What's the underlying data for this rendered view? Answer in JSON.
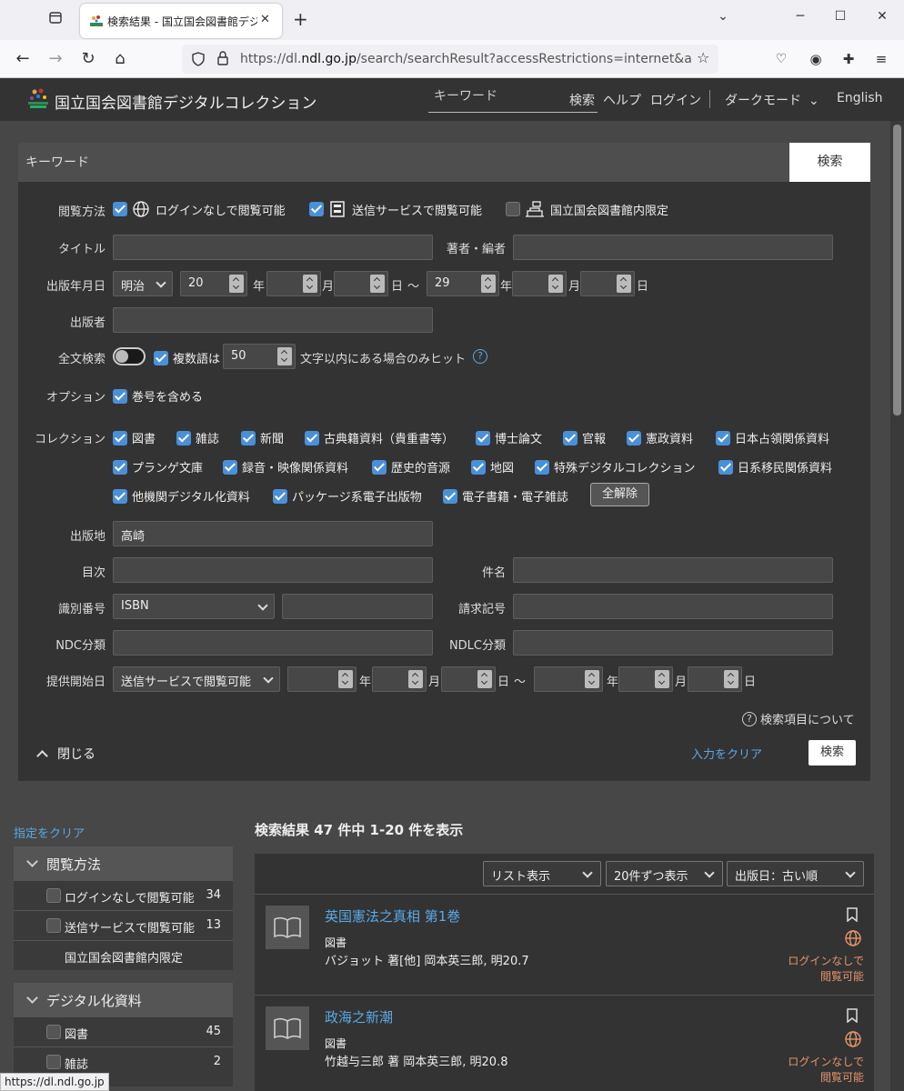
{
  "browser": {
    "tab_title": "検索結果 - 国立国会図書館デジタ",
    "url_prefix": "https://dl.",
    "url_domain": "ndl.go.jp",
    "url_rest": "/search/searchResult?accessRestrictions=internet&accessRestr",
    "status_url": "https://dl.ndl.go.jp"
  },
  "header": {
    "site_title": "国立国会図書館デジタルコレクション",
    "search_placeholder": "キーワード",
    "search_label": "検索",
    "help_label": "ヘルプ",
    "login_label": "ログイン",
    "dark_mode_label": "ダークモード",
    "english_label": "English"
  },
  "search_panel": {
    "keyword_placeholder": "キーワード",
    "search_button": "検索",
    "access": {
      "label": "閲覧方法",
      "options": [
        {
          "label": "ログインなしで閲覧可能",
          "checked": true,
          "icon": "globe-icon"
        },
        {
          "label": "送信サービスで閲覧可能",
          "checked": true,
          "icon": "building-icon"
        },
        {
          "label": "国立国会図書館内限定",
          "checked": false,
          "icon": "library-icon"
        }
      ]
    },
    "title_label": "タイトル",
    "author_label": "著者・編者",
    "pubdate": {
      "label": "出版年月日",
      "era": "明治",
      "from_year": "20",
      "to_year": "29",
      "year_unit": "年",
      "month_unit": "月",
      "day_unit": "日",
      "tilde": "～"
    },
    "publisher_label": "出版者",
    "fulltext": {
      "label": "全文検索",
      "multi_word_label": "複数語は",
      "distance": "50",
      "suffix": "文字以内にある場合のみヒット",
      "help": "?"
    },
    "option": {
      "label": "オプション",
      "include_volume": "巻号を含める"
    },
    "collection": {
      "label": "コレクション",
      "items": [
        "図書",
        "雑誌",
        "新聞",
        "古典籍資料（貴重書等）",
        "博士論文",
        "官報",
        "憲政資料",
        "日本占領関係資料",
        "プランゲ文庫",
        "録音・映像関係資料",
        "歴史的音源",
        "地図",
        "特殊デジタルコレクション",
        "日系移民関係資料",
        "他機関デジタル化資料",
        "パッケージ系電子出版物",
        "電子書籍・電子雑誌"
      ],
      "clear_all": "全解除"
    },
    "pub_place": {
      "label": "出版地",
      "value": "高崎"
    },
    "toc_label": "目次",
    "subject_label": "件名",
    "identifier": {
      "label": "識別番号",
      "type": "ISBN"
    },
    "call_number_label": "請求記号",
    "ndc_label": "NDC分類",
    "ndlc_label": "NDLC分類",
    "provision": {
      "label": "提供開始日",
      "type": "送信サービスで閲覧可能"
    },
    "about_fields": "検索項目について",
    "close_label": "閉じる",
    "clear_input": "入力をクリア",
    "bottom_search": "検索"
  },
  "sidebar": {
    "clear_label": "指定をクリア",
    "access": {
      "title": "閲覧方法",
      "items": [
        {
          "label": "ログインなしで閲覧可能",
          "count": "34"
        },
        {
          "label": "送信サービスで閲覧可能",
          "count": "13"
        },
        {
          "label": "国立国会図書館内限定",
          "count": ""
        }
      ]
    },
    "digital": {
      "title": "デジタル化資料",
      "items": [
        {
          "label": "図書",
          "count": "45"
        },
        {
          "label": "雑誌",
          "count": "2"
        }
      ]
    }
  },
  "results": {
    "summary": "検索結果 47 件中 1-20 件を表示",
    "view_mode": "リスト表示",
    "per_page": "20件ずつ表示",
    "sort": "出版日：古い順",
    "items": [
      {
        "title": "英国憲法之真相 第1巻",
        "type": "図書",
        "meta": "バジョット 著[他] 岡本英三郎, 明20.7",
        "availability_1": "ログインなしで",
        "availability_2": "閲覧可能"
      },
      {
        "title": "政海之新潮",
        "type": "図書",
        "meta": "竹越与三郎 著 岡本英三郎, 明20.8",
        "availability_1": "ログインなしで",
        "availability_2": "閲覧可能"
      }
    ]
  }
}
